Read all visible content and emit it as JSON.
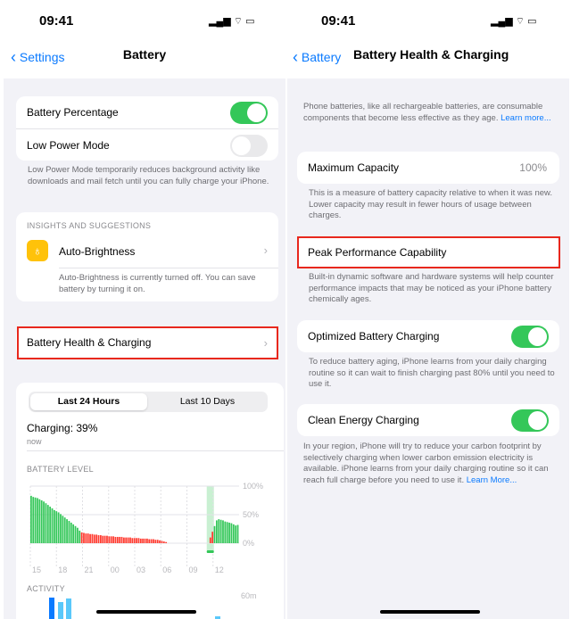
{
  "left": {
    "status_time": "09:41",
    "back_label": "Settings",
    "title": "Battery",
    "battery_percentage_label": "Battery Percentage",
    "battery_percentage_on": true,
    "low_power_label": "Low Power Mode",
    "low_power_on": false,
    "low_power_note": "Low Power Mode temporarily reduces background activity like downloads and mail fetch until you can fully charge your iPhone.",
    "insights_header": "INSIGHTS AND SUGGESTIONS",
    "auto_brightness_label": "Auto-Brightness",
    "auto_brightness_note": "Auto-Brightness is currently turned off. You can save battery by turning it on.",
    "health_label": "Battery Health & Charging",
    "seg_24h": "Last 24 Hours",
    "seg_10d": "Last 10 Days",
    "charging_text": "Charging: 39%",
    "charging_time": "now",
    "battery_level_header": "BATTERY LEVEL",
    "activity_header": "ACTIVITY",
    "activity_axis": "60m"
  },
  "chart_data": {
    "type": "bar",
    "title": "BATTERY LEVEL",
    "x_ticks": [
      "15",
      "18",
      "21",
      "00",
      "03",
      "06",
      "09",
      "12"
    ],
    "y_ticks": [
      "100%",
      "50%",
      "0%"
    ],
    "ylim": [
      0,
      100
    ],
    "colors": {
      "normal": "#34c759",
      "low": "#ff3b30",
      "charging_band": "#c9f0d2"
    },
    "levels": [
      83,
      81,
      80,
      79,
      77,
      75,
      73,
      70,
      67,
      64,
      61,
      58,
      56,
      54,
      51,
      48,
      45,
      42,
      39,
      36,
      33,
      30,
      27,
      22,
      19,
      18,
      17,
      17,
      16,
      16,
      15,
      15,
      14,
      14,
      13,
      13,
      13,
      12,
      12,
      12,
      11,
      11,
      11,
      11,
      10,
      10,
      10,
      10,
      9,
      9,
      9,
      9,
      8,
      8,
      8,
      8,
      7,
      7,
      7,
      6,
      6,
      5,
      4,
      3,
      2,
      0,
      0,
      0,
      0,
      0,
      0,
      0,
      0,
      0,
      0,
      0,
      0,
      0,
      0,
      0,
      0,
      0,
      0,
      0,
      0,
      10,
      20,
      30,
      40,
      42,
      41,
      40,
      38,
      37,
      36,
      35,
      33,
      31,
      32
    ]
  },
  "right": {
    "status_time": "09:41",
    "back_label": "Battery",
    "title": "Battery Health & Charging",
    "intro": "Phone batteries, like all rechargeable batteries, are consumable components that become less effective as they age.",
    "learn_more": "Learn more...",
    "max_capacity_label": "Maximum Capacity",
    "max_capacity_value": "100%",
    "max_capacity_note": "This is a measure of battery capacity relative to when it was new. Lower capacity may result in fewer hours of usage between charges.",
    "peak_label": "Peak Performance Capability",
    "peak_note": "Built-in dynamic software and hardware systems will help counter performance impacts that may be noticed as your iPhone battery chemically ages.",
    "optimized_label": "Optimized Battery Charging",
    "optimized_on": true,
    "optimized_note": "To reduce battery aging, iPhone learns from your daily charging routine so it can wait to finish charging past 80% until you need to use it.",
    "clean_label": "Clean Energy Charging",
    "clean_on": true,
    "clean_note": "In your region, iPhone will try to reduce your carbon footprint by selectively charging when lower carbon emission electricity is available. iPhone learns from your daily charging routine so it can reach full charge before you need to use it.",
    "learn_more2": "Learn More..."
  }
}
